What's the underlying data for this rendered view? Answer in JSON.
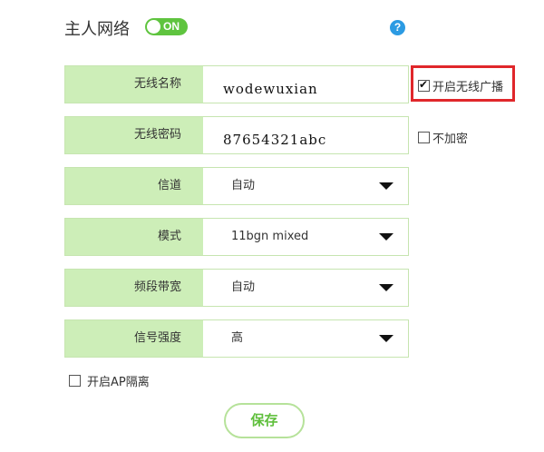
{
  "header": {
    "title": "主人网络",
    "toggle_label": "ON",
    "help_icon": "question-circle-icon",
    "help_symbol": "?"
  },
  "colors": {
    "accent_green": "#5fc43f",
    "label_bg": "#cdeeb8",
    "highlight_red": "#e0272b",
    "help_blue": "#2c9be3"
  },
  "fields": {
    "ssid": {
      "label": "无线名称",
      "value": "wodewuxian"
    },
    "password": {
      "label": "无线密码",
      "value": "87654321abc"
    },
    "channel": {
      "label": "信道",
      "value": "自动"
    },
    "mode": {
      "label": "模式",
      "value": "11bgn mixed"
    },
    "bandwidth": {
      "label": "频段带宽",
      "value": "自动"
    },
    "signal": {
      "label": "信号强度",
      "value": "高"
    }
  },
  "options": {
    "broadcast": {
      "label": "开启无线广播",
      "checked": true
    },
    "no_encrypt": {
      "label": "不加密",
      "checked": false
    },
    "ap_isolation": {
      "label": "开启AP隔离",
      "checked": false
    }
  },
  "actions": {
    "save_label": "保存"
  }
}
